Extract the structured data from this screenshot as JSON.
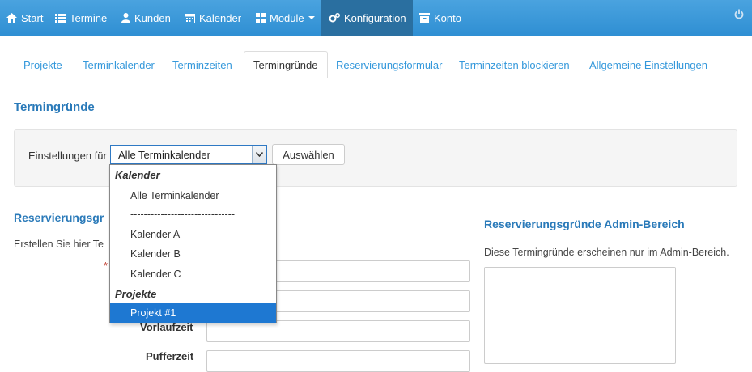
{
  "nav": {
    "items": [
      {
        "label": "Start",
        "icon": "home-icon"
      },
      {
        "label": "Termine",
        "icon": "list-icon"
      },
      {
        "label": "Kunden",
        "icon": "user-icon"
      },
      {
        "label": "Kalender",
        "icon": "calendar-icon"
      },
      {
        "label": "Module",
        "icon": "grid-icon"
      },
      {
        "label": "Konfiguration",
        "icon": "gears-icon"
      },
      {
        "label": "Konto",
        "icon": "inbox-icon"
      }
    ],
    "active": "Konfiguration",
    "color": "#3498db"
  },
  "tabs": [
    "Projekte",
    "Terminkalender",
    "Terminzeiten",
    "Termingründe",
    "Reservierungsformular",
    "Terminzeiten blockieren",
    "Allgemeine Einstellungen"
  ],
  "active_tab": "Termingründe",
  "page_title": "Termingründe",
  "filter": {
    "label": "Einstellungen für",
    "selected": "Alle Terminkalender",
    "button": "Auswählen"
  },
  "dropdown": {
    "group_kalender": "Kalender",
    "opt_all": "Alle Terminkalender",
    "opt_separator": "-------------------------------",
    "opt_a": "Kalender A",
    "opt_b": "Kalender B",
    "opt_c": "Kalender C",
    "group_projekte": "Projekte",
    "opt_projekt": "Projekt #1"
  },
  "left_section": {
    "title": "Reservierungsgr",
    "description": "Erstellen Sie hier Te",
    "required_mark": "*",
    "label_vorlauf": "Vorlaufzeit",
    "label_puffer": "Pufferzeit"
  },
  "right_section": {
    "title": "Reservierungsgründe Admin-Bereich",
    "description": "Diese Termingründe erscheinen nur im Admin-Bereich."
  }
}
